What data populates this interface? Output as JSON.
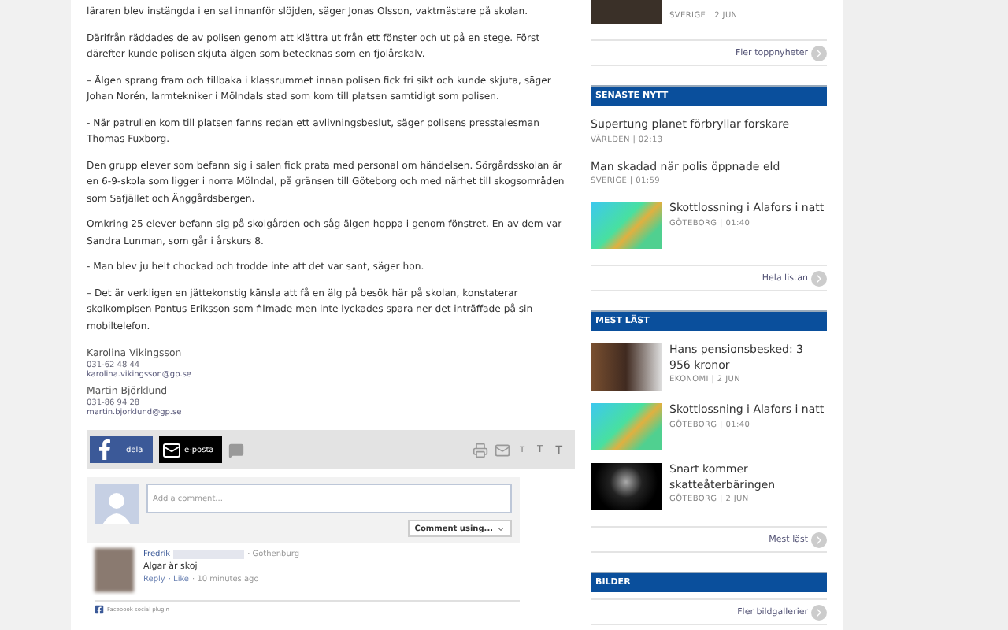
{
  "article": {
    "paragraphs": [
      "läraren blev instängda i en sal innanför slöjden, säger Jonas Olsson, vaktmästare på skolan.",
      "Därifrån räddades de av polisen genom att klättra ut från ett fönster och ut på en stege. Först därefter kunde polisen skjuta älgen som betecknas som en fjolårskalv.",
      "– Älgen sprang fram och tillbaka i klassrummet innan polisen fick fri sikt och kunde skjuta, säger Johan Norén, larmtekniker i Mölndals stad som kom till platsen samtidigt som polisen.",
      "- När patrullen kom till platsen fanns redan ett avlivningsbeslut, säger polisens presstalesman Thomas Fuxborg.",
      "Den grupp elever som befann sig i salen fick prata med personal om händelsen. Sörgårdsskolan är en 6-9-skola som ligger i norra Mölndal, på gränsen till Göteborg och med närhet till skogsområden som Safjället och Änggårdsbergen.",
      "Omkring 25 elever befann sig på skolgården och såg älgen hoppa i genom fönstret. En av dem var Sandra Lunman, som går i årskurs 8.",
      "- Man blev ju helt chockad och trodde inte att det var sant, säger hon.",
      "– Det är verkligen en jättekonstig känsla att få en älg på besök här på skolan, konstaterar skolkompisen Pontus Eriksson som filmade men inte lyckades spara ner det inträffade på sin mobiltelefon."
    ],
    "authors": [
      {
        "name": "Karolina Vikingsson",
        "phone": "031-62 48 44",
        "email": "karolina.vikingsson@gp.se"
      },
      {
        "name": "Martin Björklund",
        "phone": "031-86 94 28",
        "email": "martin.bjorklund@gp.se"
      }
    ]
  },
  "share_bar": {
    "facebook": "dela",
    "email": "e-posta",
    "text_sizes": [
      "T",
      "T",
      "T"
    ]
  },
  "comments": {
    "placeholder": "Add a comment...",
    "comment_using": "Comment using...",
    "items": [
      {
        "author": "Fredrik",
        "location": "· Gothenburg",
        "text": "Älgar är skoj",
        "reply": "Reply",
        "like": "· Like",
        "time": "· 10 minutes ago"
      }
    ],
    "plugin": "Facebook social plugin"
  },
  "sidebar": {
    "top_item_meta": "SVERIGE | 2 JUN",
    "top_more": "Fler toppnyheter",
    "sections": [
      {
        "title": "SENASTE NYTT",
        "more": "Hela listan",
        "items": [
          {
            "kind": "text",
            "title": "Supertung planet förbryllar forskare",
            "meta": "VÄRLDEN | 02:13"
          },
          {
            "kind": "text",
            "title": "Man skadad när polis öppnade eld",
            "meta": "SVERIGE | 01:59"
          },
          {
            "kind": "map",
            "title": "Skottlossning i Alafors i natt",
            "meta": "GÖTEBORG | 01:40"
          }
        ]
      },
      {
        "title": "MEST LÄST",
        "more": "Mest läst",
        "items": [
          {
            "kind": "photo",
            "title": "Hans pensionsbesked: 3 956 kronor",
            "meta": "EKONOMI | 2 JUN"
          },
          {
            "kind": "map",
            "title": "Skottlossning i Alafors i natt",
            "meta": "GÖTEBORG | 01:40"
          },
          {
            "kind": "dark",
            "title": "Snart kommer skatteåterbäringen",
            "meta": "GÖTEBORG | 2 JUN"
          }
        ]
      },
      {
        "title": "BILDER",
        "more": "Fler bildgallerier"
      }
    ]
  }
}
